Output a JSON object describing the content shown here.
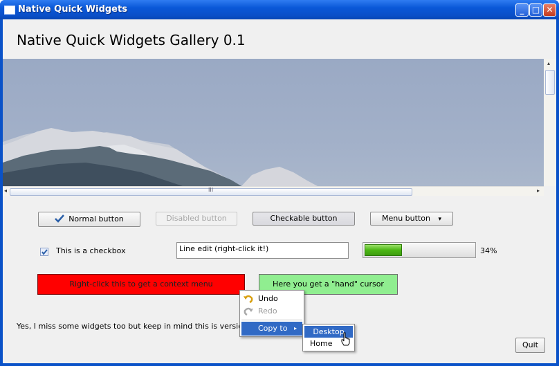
{
  "window": {
    "title": "Native Quick Widgets",
    "minimize_glyph": "_",
    "maximize_glyph": "□",
    "close_glyph": "✕"
  },
  "heading": "Native Quick Widgets Gallery 0.1",
  "scrollbars": {
    "horizontal_grip": "III",
    "left_arrow": "◂",
    "right_arrow": "▸",
    "up_arrow": "▴",
    "down_arrow": "▾"
  },
  "buttons": {
    "normal": "Normal button",
    "disabled": "Disabled button",
    "checkable": "Checkable button",
    "menu": "Menu button",
    "menu_arrow": "▾",
    "quit": "Quit"
  },
  "checkbox": {
    "label": "This is a checkbox",
    "checked": true
  },
  "line_edit": {
    "value": "Line edit (right-click it!)"
  },
  "progress": {
    "value": 34,
    "label": "34%"
  },
  "context_area": {
    "label": "Right-click this to get a context menu",
    "color": "#ff0000"
  },
  "hand_area": {
    "label": "Here you get a \"hand\" cursor",
    "color": "#90ee90"
  },
  "footer_note": "Yes, I miss some widgets too but keep in mind this is version 0.1!",
  "context_menu": {
    "undo": "Undo",
    "redo": "Redo",
    "copy_to": "Copy to",
    "submenu_arrow": "▸",
    "submenu": {
      "desktop": "Desktop",
      "home": "Home"
    }
  },
  "colors": {
    "accent": "#316ac5",
    "progress_fill": "#4bb714",
    "titlebar": "#0a58d8"
  }
}
